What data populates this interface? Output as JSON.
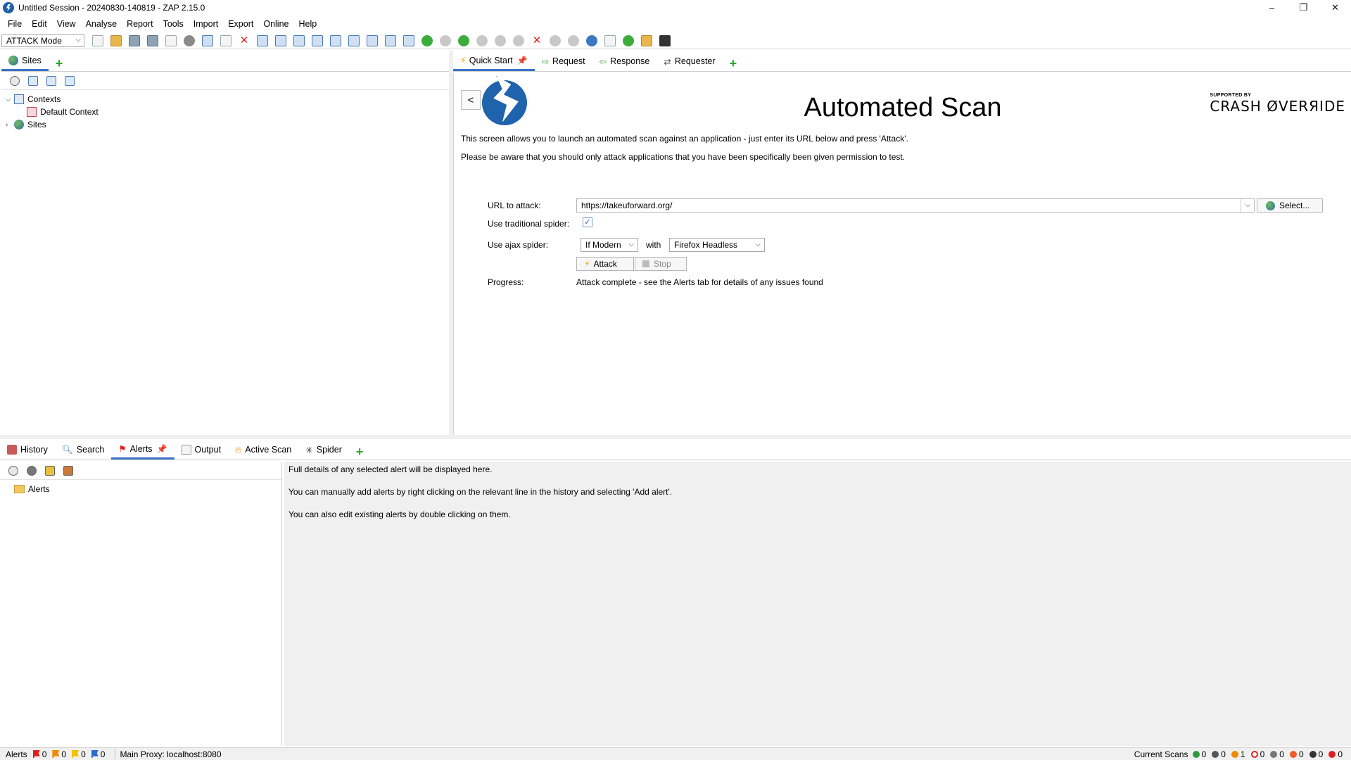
{
  "window": {
    "title": "Untitled Session - 20240830-140819 - ZAP 2.15.0",
    "minimize": "–",
    "restore": "❐",
    "close": "✕"
  },
  "menu": [
    "File",
    "Edit",
    "View",
    "Analyse",
    "Report",
    "Tools",
    "Import",
    "Export",
    "Online",
    "Help"
  ],
  "toolbar": {
    "mode": "ATTACK Mode"
  },
  "left_panel": {
    "tab": "Sites",
    "tree": {
      "contexts": "Contexts",
      "default_context": "Default Context",
      "sites": "Sites"
    }
  },
  "right_panel": {
    "tabs": [
      "Quick Start",
      "Request",
      "Response",
      "Requester"
    ],
    "quick_start": {
      "back": "<",
      "title": "Automated Scan",
      "sponsor_small": "SUPPORTED BY",
      "sponsor_big": "CRASH ØVERЯIDE",
      "intro_1": "This screen allows you to launch an automated scan against  an application - just enter its URL below and press 'Attack'.",
      "intro_2": "Please be aware that you should only attack applications that you have been specifically been given permission to test.",
      "url_label": "URL to attack:",
      "url_value": "https://takeuforward.org/",
      "select_label": "Select...",
      "trad_spider_label": "Use traditional spider:",
      "trad_spider_checked": true,
      "ajax_spider_label": "Use ajax spider:",
      "ajax_spider_value": "If Modern",
      "with_label": "with",
      "browser_value": "Firefox Headless",
      "attack_label": "Attack",
      "stop_label": "Stop",
      "progress_label": "Progress:",
      "progress_value": "Attack complete - see the Alerts tab for details of any issues found"
    }
  },
  "bottom_panel": {
    "tabs": [
      "History",
      "Search",
      "Alerts",
      "Output",
      "Active Scan",
      "Spider"
    ],
    "active_tab": "Alerts",
    "alerts_root": "Alerts",
    "details": [
      "Full details of any selected alert will be displayed here.",
      "You can manually add alerts by right clicking on the relevant line in the history and selecting 'Add alert'.",
      "You can also edit existing alerts by double clicking on them."
    ]
  },
  "statusbar": {
    "alerts_label": "Alerts",
    "high": "0",
    "medium": "0",
    "low": "0",
    "info": "0",
    "proxy": "Main Proxy: localhost:8080",
    "current_scans": "Current Scans",
    "scan_counts": [
      "0",
      "0",
      "1",
      "0",
      "0",
      "0",
      "0",
      "0"
    ],
    "colors": {
      "high": "#e02020",
      "medium": "#f08a00",
      "low": "#f2c200",
      "info": "#2a6bd1"
    }
  }
}
